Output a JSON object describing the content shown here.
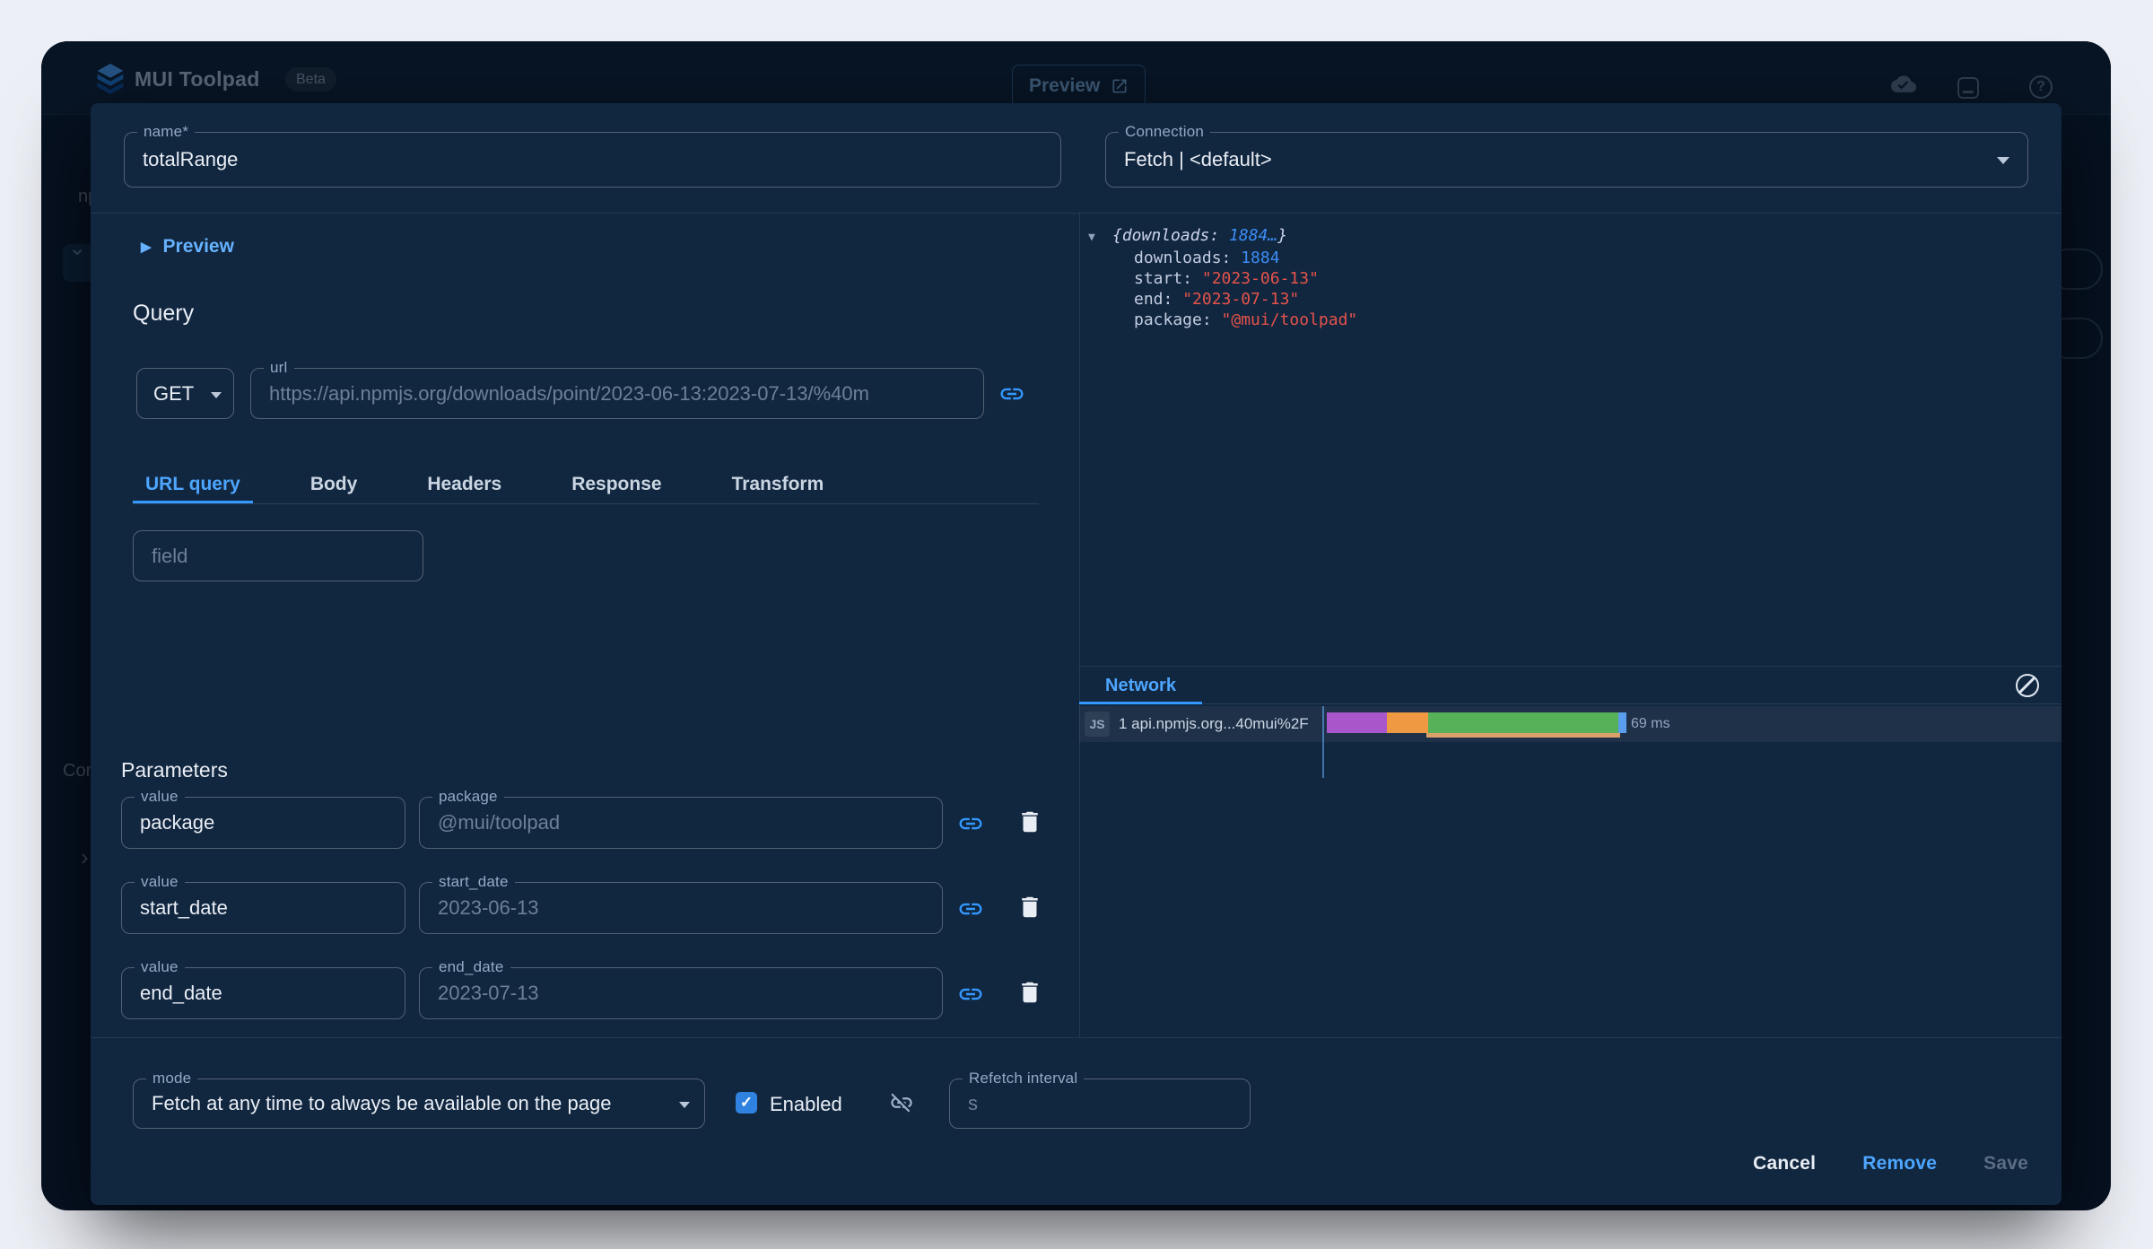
{
  "appbar": {
    "title": "MUI Toolpad",
    "beta": "Beta",
    "preview": "Preview"
  },
  "background": {
    "sidebar_top": "np",
    "sidebar_bottom": "Cor"
  },
  "glyphs": {
    "play": "▶",
    "json_arrow": "▼",
    "check": "✓",
    "question": "?",
    "chevron_down": "⌄",
    "chevron_right": "›"
  },
  "dialog": {
    "name": {
      "label": "name*",
      "value": "totalRange"
    },
    "connection": {
      "label": "Connection",
      "value": "Fetch | <default>"
    },
    "preview_toggle": "Preview",
    "query_title": "Query",
    "method": "GET",
    "url": {
      "label": "url",
      "value": "https://api.npmjs.org/downloads/point/2023-06-13:2023-07-13/%40m"
    },
    "tabs": [
      "URL query",
      "Body",
      "Headers",
      "Response",
      "Transform"
    ],
    "field_placeholder": "field",
    "parameters_title": "Parameters",
    "parameters": [
      {
        "label": "value",
        "value": "package",
        "bind_label": "package",
        "bind_value": "@mui/toolpad"
      },
      {
        "label": "value",
        "value": "start_date",
        "bind_label": "start_date",
        "bind_value": "2023-06-13"
      },
      {
        "label": "value",
        "value": "end_date",
        "bind_label": "end_date",
        "bind_value": "2023-07-13"
      }
    ],
    "mode": {
      "label": "mode",
      "value": "Fetch at any time to always be available on the page"
    },
    "enabled_label": "Enabled",
    "refetch": {
      "label": "Refetch interval",
      "value": "s"
    },
    "actions": {
      "cancel": "Cancel",
      "remove": "Remove",
      "save": "Save"
    }
  },
  "result": {
    "summary_prefix": "{downloads: ",
    "summary_number": "1884…",
    "summary_suffix": "}",
    "entries": [
      {
        "key": "downloads:",
        "value": "1884"
      },
      {
        "key": "start:",
        "value": "\"2023-06-13\""
      },
      {
        "key": "end:",
        "value": "\"2023-07-13\""
      },
      {
        "key": "package:",
        "value": "\"@mui/toolpad\""
      }
    ]
  },
  "network": {
    "tab": "Network",
    "badge": "JS",
    "request_label": "1 api.npmjs.org...40mui%2F",
    "duration": "69 ms"
  },
  "colors": {
    "accent": "#3399FF",
    "accent_light": "#66B2FF",
    "json_number": "#3D8DF5",
    "json_string": "#E5534B",
    "waterfall_purple": "#A757C9",
    "waterfall_orange": "#EF9A43",
    "waterfall_green": "#57B158",
    "waterfall_blue": "#5B9DED"
  }
}
